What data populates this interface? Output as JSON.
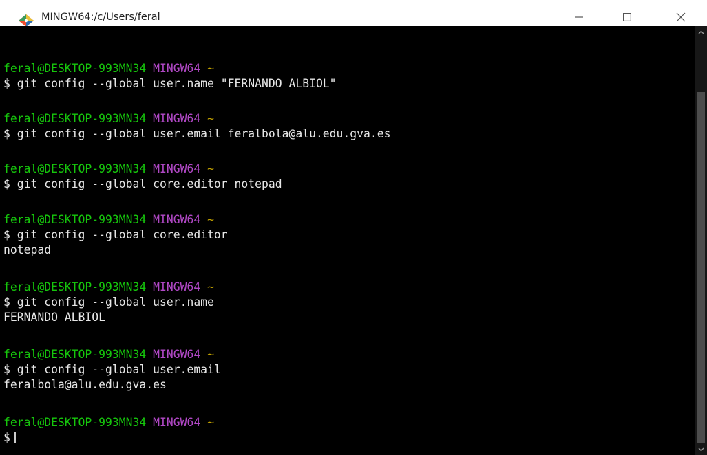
{
  "window": {
    "title": "MINGW64:/c/Users/feral",
    "icons": {
      "app": "git-diamond-icon",
      "minimize": "minimize-icon",
      "maximize": "maximize-icon",
      "close": "close-icon"
    }
  },
  "terminal": {
    "prompt": {
      "user": "feral@DESKTOP-993MN34",
      "shell": "MINGW64",
      "path": "~",
      "symbol": "$"
    },
    "entries": [
      {
        "command": "git config --global user.name \"FERNANDO ALBIOL\"",
        "output": ""
      },
      {
        "command": "git config --global user.email feralbola@alu.edu.gva.es",
        "output": ""
      },
      {
        "command": "git config --global core.editor notepad",
        "output": ""
      },
      {
        "command": "git config --global core.editor",
        "output": "notepad"
      },
      {
        "command": "git config --global user.name",
        "output": "FERNANDO ALBIOL"
      },
      {
        "command": "git config --global user.email",
        "output": "feralbola@alu.edu.gva.es"
      }
    ],
    "current_input": ""
  },
  "colors": {
    "prompt_user": "#16c60c",
    "prompt_shell": "#b148c6",
    "prompt_tilde": "#c0a000",
    "text": "#e6e6e6",
    "background": "#000000"
  }
}
